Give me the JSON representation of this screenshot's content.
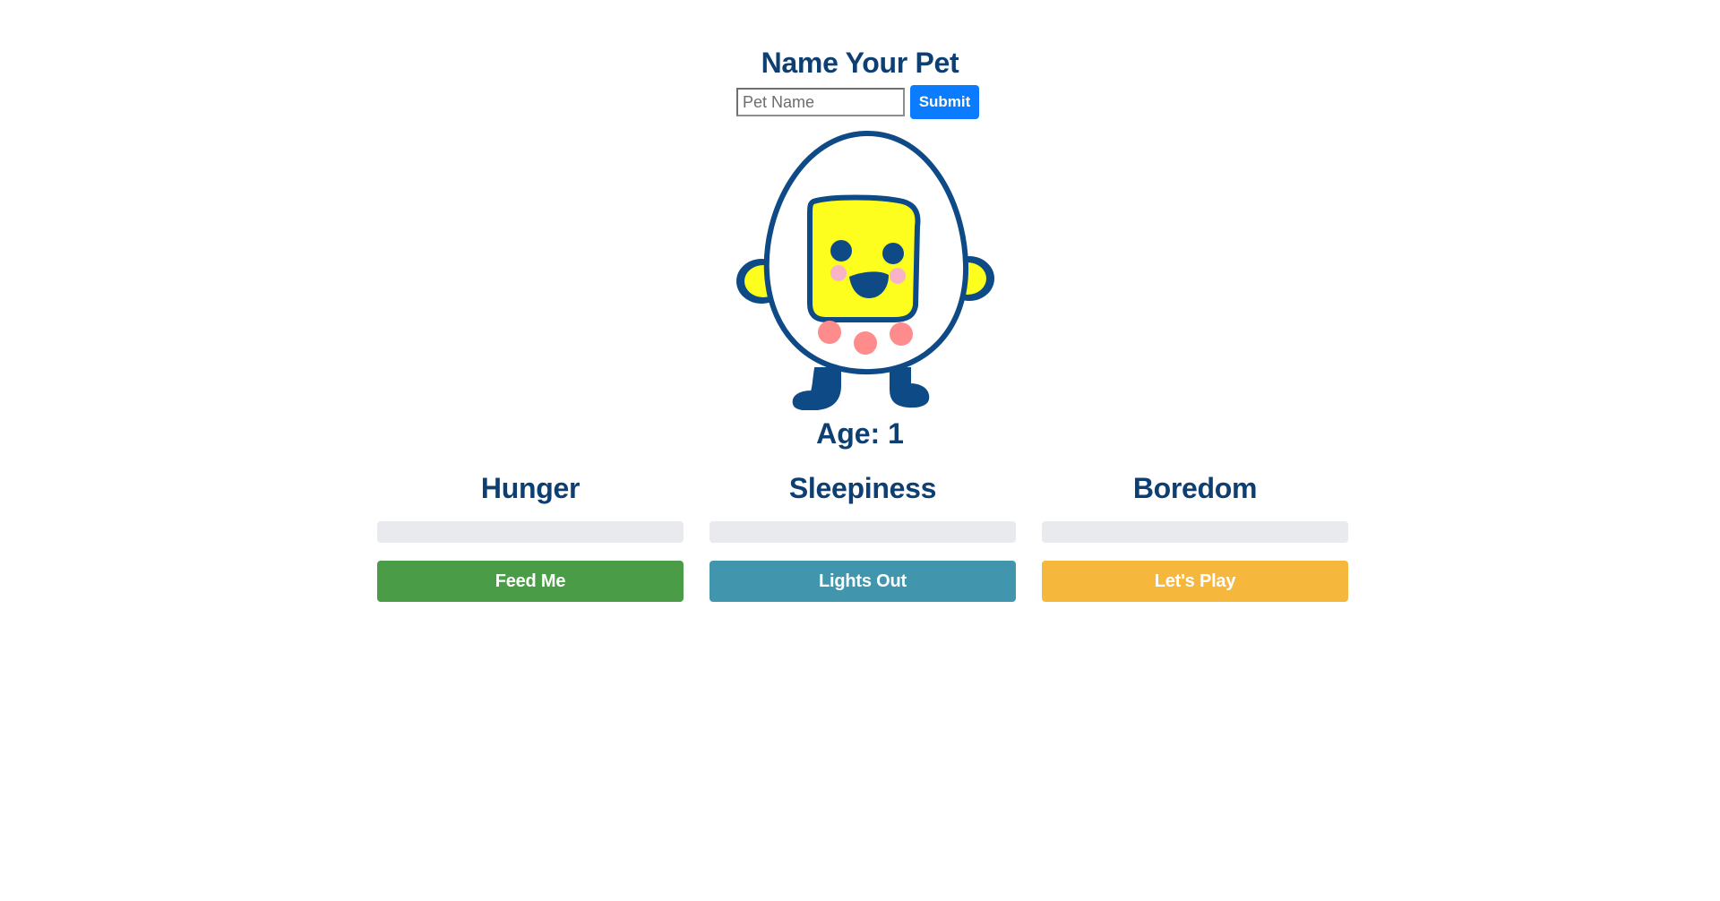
{
  "name_form": {
    "title": "Name Your Pet",
    "input_placeholder": "Pet Name",
    "input_value": "",
    "submit_label": "Submit"
  },
  "pet": {
    "age_text": "Age: 1"
  },
  "stats": [
    {
      "label": "Hunger",
      "progress": 0,
      "button_label": "Feed Me",
      "button_color": "#4a9c46"
    },
    {
      "label": "Sleepiness",
      "progress": 0,
      "button_label": "Lights Out",
      "button_color": "#4196ad"
    },
    {
      "label": "Boredom",
      "progress": 0,
      "button_label": "Let's Play",
      "button_color": "#f6b73d"
    }
  ],
  "colors": {
    "heading": "#0e3f73",
    "submit": "#0b7bff",
    "progress_track": "#e8eaed",
    "pet_outline": "#0e4a86",
    "pet_face": "#fdfd1e",
    "pet_spots": "#ff8c8c",
    "pet_cheeks": "#f9b3c6"
  }
}
